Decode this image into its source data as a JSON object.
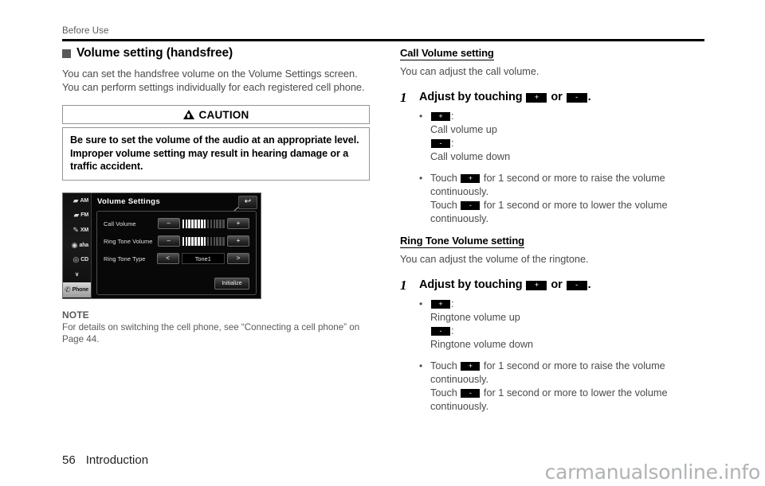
{
  "header": {
    "running_head": "Before Use"
  },
  "left": {
    "section_title": "Volume setting (handsfree)",
    "intro": "You can set the handsfree volume on the Volume Settings screen. You can perform settings individually for each registered cell phone.",
    "caution": {
      "label": "CAUTION",
      "text": "Be sure to set the volume of the audio at an appropriate level. Improper volume setting may result in hearing damage or a traffic accident."
    },
    "head_unit": {
      "title": "Volume Settings",
      "back_icon": "↩",
      "side_items": [
        {
          "label": "AM",
          "icon": "📻",
          "active": false
        },
        {
          "label": "FM",
          "icon": "📻",
          "active": false
        },
        {
          "label": "XM",
          "icon": "📡",
          "active": false
        },
        {
          "label": "aha",
          "icon": "◉",
          "active": false
        },
        {
          "label": "CD",
          "icon": "💿",
          "active": false
        },
        {
          "label": "∨",
          "icon": "",
          "active": false
        },
        {
          "label": "Phone",
          "icon": "📞",
          "active": true
        }
      ],
      "rows": [
        {
          "label": "Call Volume",
          "minus": "–",
          "plus": "+",
          "type": "meter",
          "segments": 16,
          "filled": 8
        },
        {
          "label": "Ring Tone Volume",
          "minus": "–",
          "plus": "+",
          "type": "meter",
          "segments": 16,
          "filled": 8
        },
        {
          "label": "Ring Tone Type",
          "minus": "<",
          "plus": ">",
          "type": "value",
          "value": "Tone1"
        }
      ],
      "initialize_label": "Initialize"
    },
    "note": {
      "title": "NOTE",
      "text": "For details on switching the cell phone, see “Connecting a cell phone” on Page 44."
    }
  },
  "right": {
    "sections": [
      {
        "heading": "Call Volume setting",
        "intro": "You can adjust the call volume.",
        "step_number": "1",
        "step_prefix": "Adjust by touching",
        "step_key_plus": "+",
        "step_or": "or",
        "step_key_minus": "-",
        "step_suffix": ".",
        "bullet1": {
          "key_plus": "+",
          "colon": ":",
          "plus_desc": "Call volume up",
          "key_minus": "-",
          "minus_desc": "Call volume down"
        },
        "bullet2": {
          "touch": "Touch",
          "key_plus": "+",
          "raise_text": "for 1 second or more to raise the volume continuously.",
          "key_minus": "-",
          "lower_text": "for 1 second or more to lower the volume continuously."
        }
      },
      {
        "heading": "Ring Tone Volume setting",
        "intro": "You can adjust the volume of the ringtone.",
        "step_number": "1",
        "step_prefix": "Adjust by touching",
        "step_key_plus": "+",
        "step_or": "or",
        "step_key_minus": "-",
        "step_suffix": ".",
        "bullet1": {
          "key_plus": "+",
          "colon": ":",
          "plus_desc": "Ringtone volume up",
          "key_minus": "-",
          "minus_desc": "Ringtone volume down"
        },
        "bullet2": {
          "touch": "Touch",
          "key_plus": "+",
          "raise_text": "for 1 second or more to raise the volume continuously.",
          "key_minus": "-",
          "lower_text": "for 1 second or more to lower the volume continuously."
        }
      }
    ]
  },
  "footer": {
    "page_number": "56",
    "section_name": "Introduction",
    "watermark": "carmanualsonline.info"
  }
}
